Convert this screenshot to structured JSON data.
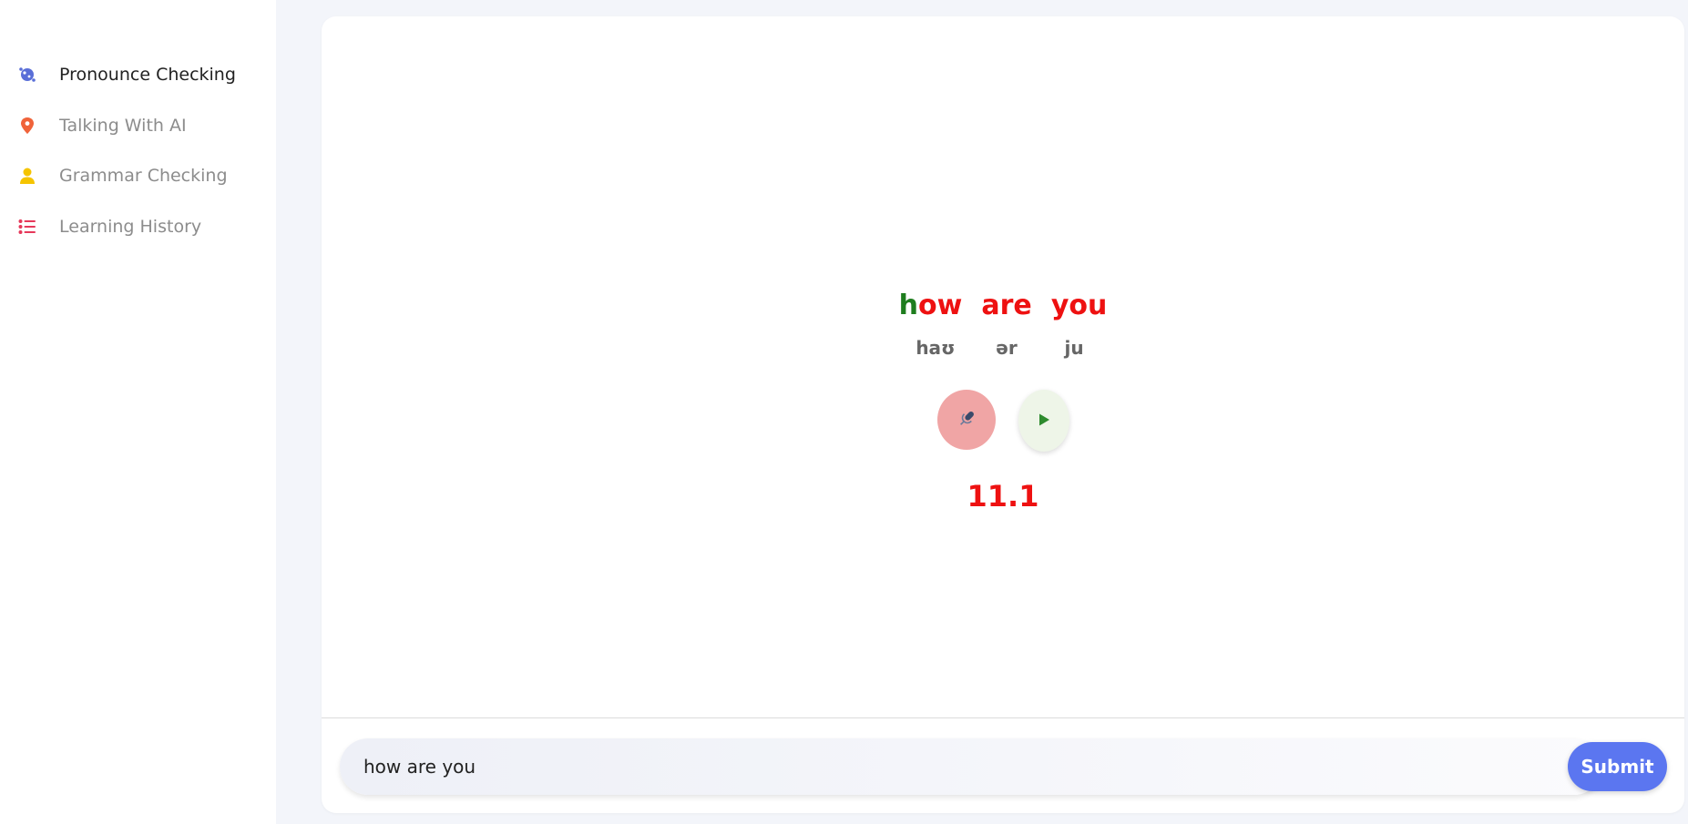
{
  "sidebar": {
    "items": [
      {
        "label": "Pronounce Checking",
        "icon": "globe-icon",
        "color": "#5a6fd8",
        "active": true
      },
      {
        "label": "Talking With AI",
        "icon": "location-pin-icon",
        "color": "#f0633a",
        "active": false
      },
      {
        "label": "Grammar Checking",
        "icon": "user-icon",
        "color": "#f5c400",
        "active": false
      },
      {
        "label": "Learning History",
        "icon": "list-icon",
        "color": "#e6385a",
        "active": false
      }
    ]
  },
  "main": {
    "words": [
      {
        "segments": [
          {
            "text": "h",
            "color": "#1e7d1e"
          },
          {
            "text": "ow",
            "color": "#ee1111"
          }
        ]
      },
      {
        "segments": [
          {
            "text": "are",
            "color": "#ee1111"
          }
        ]
      },
      {
        "segments": [
          {
            "text": "you",
            "color": "#ee1111"
          }
        ]
      }
    ],
    "phonetics": [
      "haʊ",
      "ər",
      "ju"
    ],
    "score": "11.1",
    "score_color": "#ee1111",
    "mic_icon": "microphone-icon",
    "play_icon": "play-icon"
  },
  "input": {
    "value": "how are you"
  },
  "submit": {
    "label": "Submit"
  }
}
